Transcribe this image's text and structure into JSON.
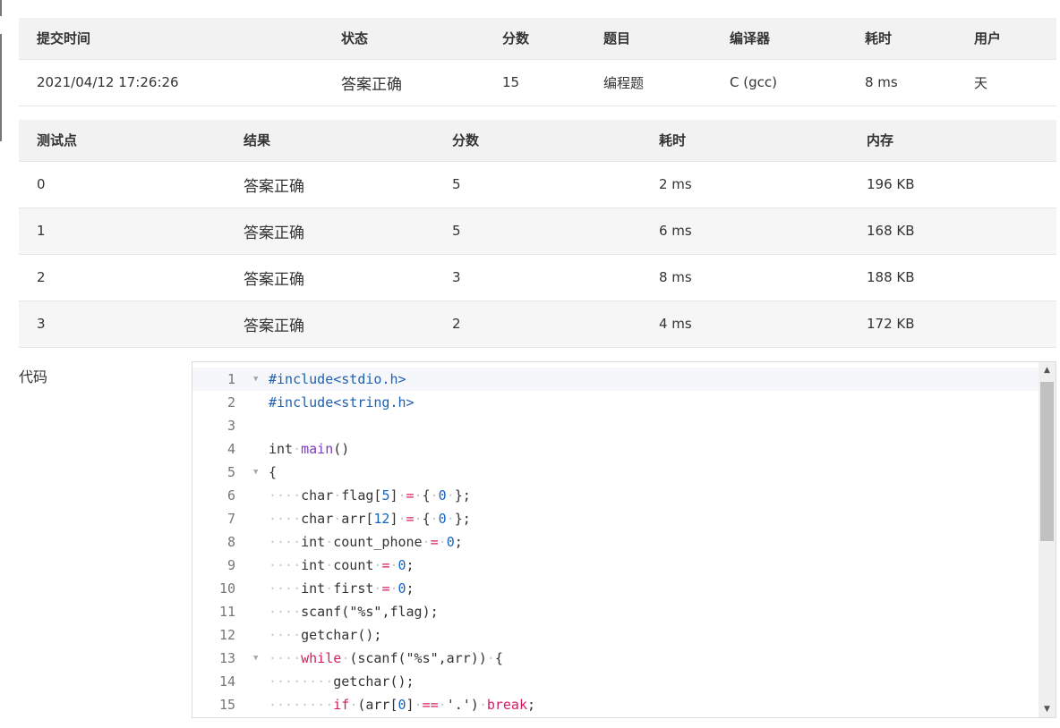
{
  "summary": {
    "headers": [
      "提交时间",
      "状态",
      "分数",
      "题目",
      "编译器",
      "耗时",
      "用户"
    ],
    "row": [
      "2021/04/12 17:26:26",
      "答案正确",
      "15",
      "编程题",
      "C (gcc)",
      "8 ms",
      "天"
    ]
  },
  "cases": {
    "headers": [
      "测试点",
      "结果",
      "分数",
      "耗时",
      "内存"
    ],
    "rows": [
      [
        "0",
        "答案正确",
        "5",
        "2 ms",
        "196 KB"
      ],
      [
        "1",
        "答案正确",
        "5",
        "6 ms",
        "168 KB"
      ],
      [
        "2",
        "答案正确",
        "3",
        "8 ms",
        "188 KB"
      ],
      [
        "3",
        "答案正确",
        "2",
        "4 ms",
        "172 KB"
      ]
    ]
  },
  "code": {
    "label": "代码",
    "line_numbers": [
      "1",
      "2",
      "3",
      "4",
      "5",
      "6",
      "7",
      "8",
      "9",
      "10",
      "11",
      "12",
      "13",
      "14",
      "15"
    ],
    "lines": [
      "#include<stdio.h>",
      "#include<string.h>",
      "",
      "int main()",
      "{",
      "    char flag[5] = { 0 };",
      "    char arr[12] = { 0 };",
      "    int count_phone = 0;",
      "    int count = 0;",
      "    int first = 0;",
      "    scanf(\"%s\",flag);",
      "    getchar();",
      "    while (scanf(\"%s\",arr)) {",
      "        getchar();",
      "        if (arr[0] == '.') break;"
    ],
    "fold_lines": [
      1,
      5,
      13
    ]
  },
  "colors": {
    "status_ok": "#f44336",
    "header_bg": "#f2f2f2",
    "keyword": "#d81b60",
    "preprocessor": "#2060b0",
    "function": "#7b3bc0",
    "number": "#1565c0"
  },
  "icons": {
    "fold": "triangle-down-icon",
    "scroll_up": "scroll-up-arrow-icon",
    "scroll_down": "scroll-down-arrow-icon"
  }
}
